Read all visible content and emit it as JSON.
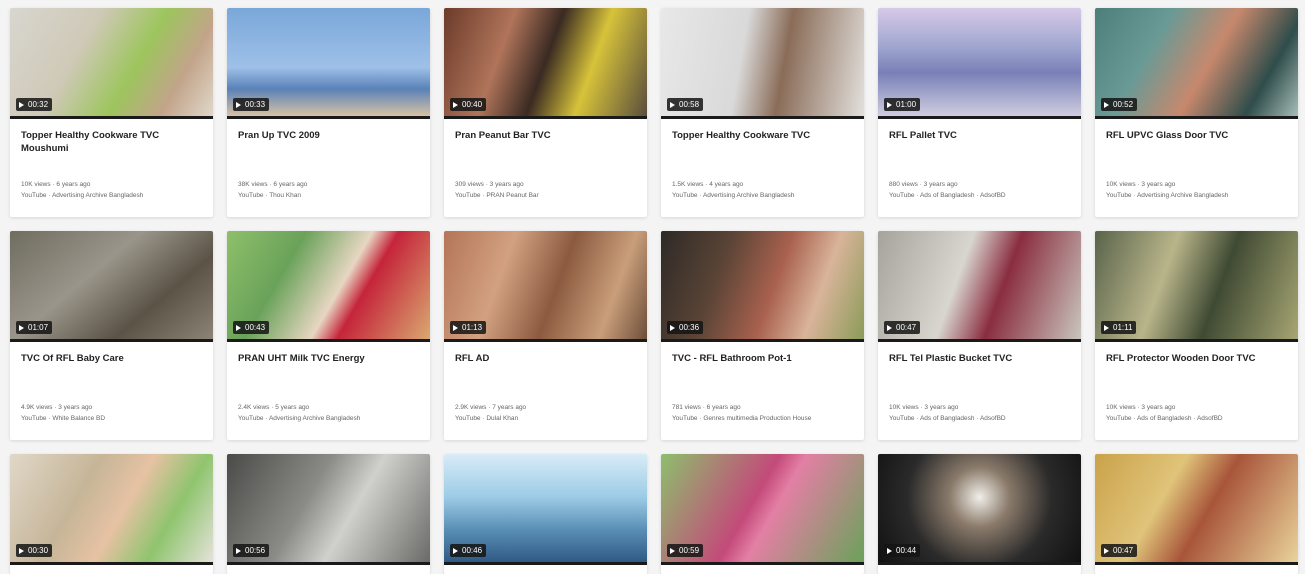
{
  "videos": [
    {
      "title": "Topper Healthy Cookware TVC Moushumi",
      "duration": "00:32",
      "meta_views": "10K views · 6 years ago",
      "meta_source": "YouTube · Advertising Archive Bangladesh"
    },
    {
      "title": "Pran Up TVC 2009",
      "duration": "00:33",
      "meta_views": "38K views · 6 years ago",
      "meta_source": "YouTube · Thou Khan"
    },
    {
      "title": "Pran Peanut Bar TVC",
      "duration": "00:40",
      "meta_views": "309 views · 3 years ago",
      "meta_source": "YouTube · PRAN Peanut Bar"
    },
    {
      "title": "Topper Healthy Cookware TVC",
      "duration": "00:58",
      "meta_views": "1.5K views · 4 years ago",
      "meta_source": "YouTube · Advertising Archive Bangladesh"
    },
    {
      "title": "RFL Pallet TVC",
      "duration": "01:00",
      "meta_views": "880 views · 3 years ago",
      "meta_source": "YouTube · Ads of Bangladesh · AdsofBD"
    },
    {
      "title": "RFL UPVC Glass Door TVC",
      "duration": "00:52",
      "meta_views": "10K views · 3 years ago",
      "meta_source": "YouTube · Advertising Archive Bangladesh"
    },
    {
      "title": "TVC Of RFL Baby Care",
      "duration": "01:07",
      "meta_views": "4.9K views · 3 years ago",
      "meta_source": "YouTube · White Balance BD"
    },
    {
      "title": "PRAN UHT Milk TVC Energy",
      "duration": "00:43",
      "meta_views": "2.4K views · 5 years ago",
      "meta_source": "YouTube · Advertising Archive Bangladesh"
    },
    {
      "title": "RFL AD",
      "duration": "01:13",
      "meta_views": "2.9K views · 7 years ago",
      "meta_source": "YouTube · Dulal Khan"
    },
    {
      "title": "TVC - RFL Bathroom Pot-1",
      "duration": "00:36",
      "meta_views": "781 views · 6 years ago",
      "meta_source": "YouTube · Genres multimedia Production House"
    },
    {
      "title": "RFL Tel Plastic Bucket TVC",
      "duration": "00:47",
      "meta_views": "10K views · 3 years ago",
      "meta_source": "YouTube · Ads of Bangladesh · AdsofBD"
    },
    {
      "title": "RFL Protector Wooden Door TVC",
      "duration": "01:11",
      "meta_views": "10K views · 3 years ago",
      "meta_source": "YouTube · Ads of Bangladesh · AdsofBD"
    },
    {
      "duration": "00:30"
    },
    {
      "duration": "00:56"
    },
    {
      "duration": "00:46"
    },
    {
      "duration": "00:59"
    },
    {
      "duration": "00:44"
    },
    {
      "duration": "00:47"
    }
  ]
}
